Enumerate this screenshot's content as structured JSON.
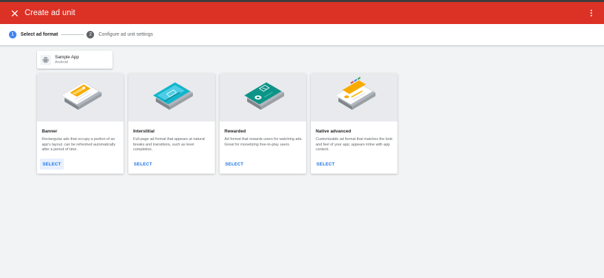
{
  "header": {
    "title": "Create ad unit",
    "close_icon": "close-icon",
    "more_icon": "more-vert-icon"
  },
  "stepper": {
    "steps": [
      {
        "number": "1",
        "label": "Select ad format",
        "active": true
      },
      {
        "number": "2",
        "label": "Configure ad unit settings",
        "active": false
      }
    ]
  },
  "app": {
    "name": "Sample App",
    "platform": "Android",
    "icon": "android-icon"
  },
  "formats": [
    {
      "title": "Banner",
      "description": "Rectangular ads that occupy a portion of an app's layout; can be refreshed automatically after a period of time.",
      "button": "SELECT",
      "illustration": "banner-illustration",
      "accent": "#f9ab00"
    },
    {
      "title": "Interstitial",
      "description": "Full-page ad format that appears at natural breaks and transitions, such as level completion.",
      "button": "SELECT",
      "illustration": "interstitial-illustration",
      "accent": "#12b5cb"
    },
    {
      "title": "Rewarded",
      "description": "Ad format that rewards users for watching ads. Great for monetizing free-to-play users.",
      "button": "SELECT",
      "illustration": "rewarded-illustration",
      "accent": "#0d9488"
    },
    {
      "title": "Native advanced",
      "description": "Customizable ad format that matches the look and feel of your app; appears inline with app content.",
      "button": "SELECT",
      "illustration": "native-illustration",
      "accent": "#f9ab00"
    }
  ],
  "colors": {
    "header_bg": "#dc3125",
    "step_active": "#4285f4",
    "link": "#1a73e8"
  }
}
